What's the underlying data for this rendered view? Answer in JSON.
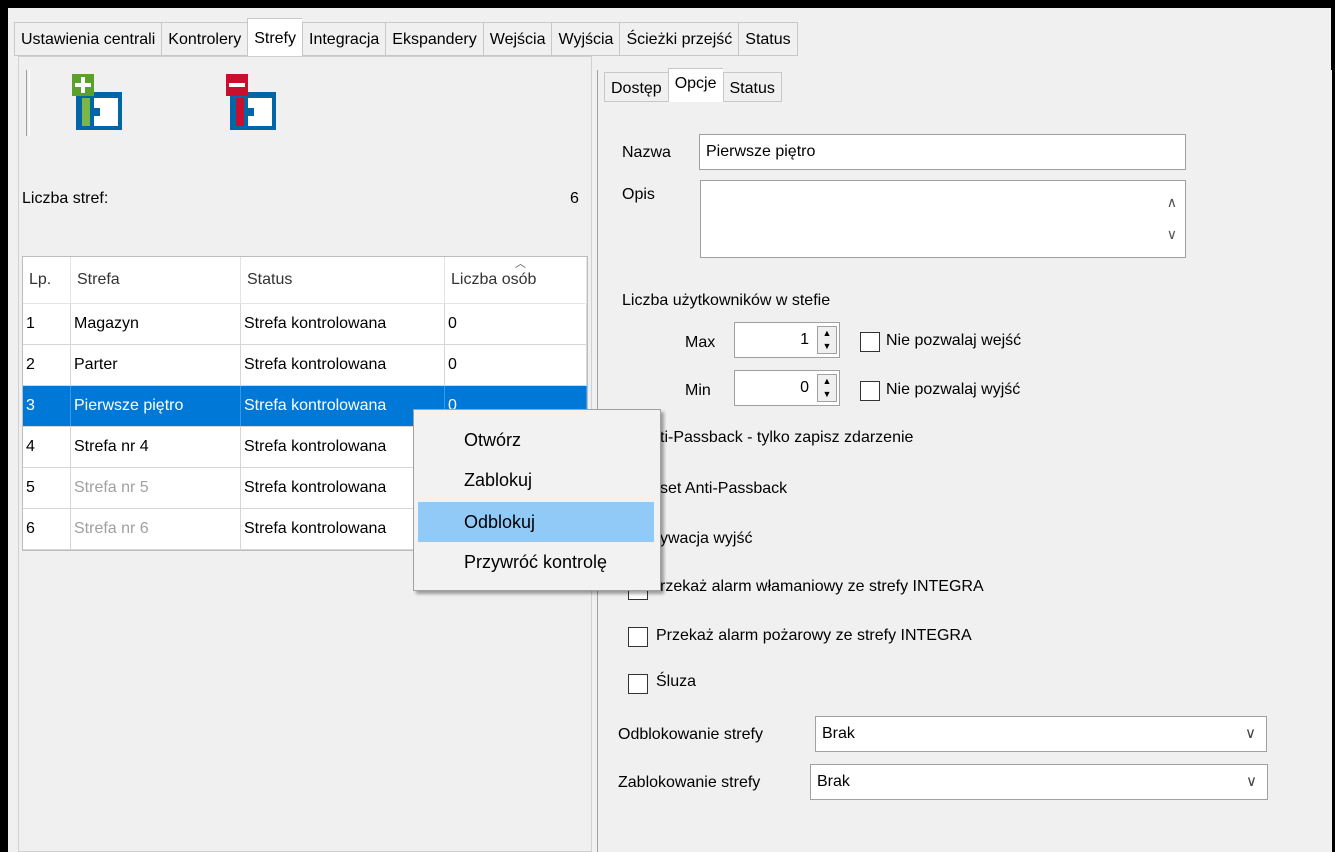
{
  "main_tabs": [
    {
      "label": "Ustawienia centrali",
      "active": false
    },
    {
      "label": "Kontrolery",
      "active": false
    },
    {
      "label": "Strefy",
      "active": true
    },
    {
      "label": "Integracja",
      "active": false
    },
    {
      "label": "Ekspandery",
      "active": false
    },
    {
      "label": "Wejścia",
      "active": false
    },
    {
      "label": "Wyjścia",
      "active": false
    },
    {
      "label": "Ścieżki przejść",
      "active": false
    },
    {
      "label": "Status",
      "active": false
    }
  ],
  "toolbar": {
    "add_icon": "add-zone-icon",
    "remove_icon": "remove-zone-icon"
  },
  "zones": {
    "count_label": "Liczba stref:",
    "count_value": "6",
    "columns": [
      "Lp.",
      "Strefa",
      "Status",
      "Liczba osób"
    ],
    "rows": [
      {
        "lp": "1",
        "name": "Magazyn",
        "status": "Strefa kontrolowana",
        "count": "0",
        "selected": false,
        "dim": false
      },
      {
        "lp": "2",
        "name": "Parter",
        "status": "Strefa kontrolowana",
        "count": "0",
        "selected": false,
        "dim": false
      },
      {
        "lp": "3",
        "name": "Pierwsze piętro",
        "status": "Strefa kontrolowana",
        "count": "0",
        "selected": true,
        "dim": false
      },
      {
        "lp": "4",
        "name": "Strefa nr 4",
        "status": "Strefa kontrolowana",
        "count": "0",
        "selected": false,
        "dim": false
      },
      {
        "lp": "5",
        "name": "Strefa nr 5",
        "status": "Strefa kontrolowana",
        "count": "0",
        "selected": false,
        "dim": true
      },
      {
        "lp": "6",
        "name": "Strefa nr 6",
        "status": "Strefa kontrolowana",
        "count": "0",
        "selected": false,
        "dim": true
      }
    ]
  },
  "sub_tabs": [
    {
      "label": "Dostęp",
      "active": false
    },
    {
      "label": "Opcje",
      "active": true
    },
    {
      "label": "Status",
      "active": false
    }
  ],
  "options": {
    "name_label": "Nazwa",
    "name_value": "Pierwsze piętro",
    "desc_label": "Opis",
    "desc_value": "",
    "users_label": "Liczba użytkowników w stefie",
    "max_label": "Max",
    "max_value": "1",
    "min_label": "Min",
    "min_value": "0",
    "no_enter_label": "Nie pozwalaj wejść",
    "no_exit_label": "Nie pozwalaj wyjść",
    "antipassback_label": "ti-Passback - tylko zapisz zdarzenie",
    "reset_label": "set Anti-Passback",
    "outputs_label": "ywacja wyjść",
    "burglary_label": "rzekaż alarm włamaniowy ze strefy INTEGRA",
    "fire_label": "Przekaż alarm pożarowy ze strefy INTEGRA",
    "airlock_label": "Śluza",
    "unlock_label": "Odblokowanie strefy",
    "unlock_value": "Brak",
    "lock_label": "Zablokowanie strefy",
    "lock_value": "Brak"
  },
  "context_menu": {
    "items": [
      {
        "label": "Otwórz",
        "highlighted": false
      },
      {
        "label": "Zablokuj",
        "highlighted": false
      },
      {
        "label": "Odblokuj",
        "highlighted": true
      },
      {
        "label": "Przywróć kontrolę",
        "highlighted": false
      }
    ]
  },
  "colors": {
    "selection": "#0078d7",
    "menu_highlight": "#91c9f7",
    "add_green": "#5aa02c",
    "remove_red": "#c8102e",
    "icon_blue": "#0066a8"
  }
}
